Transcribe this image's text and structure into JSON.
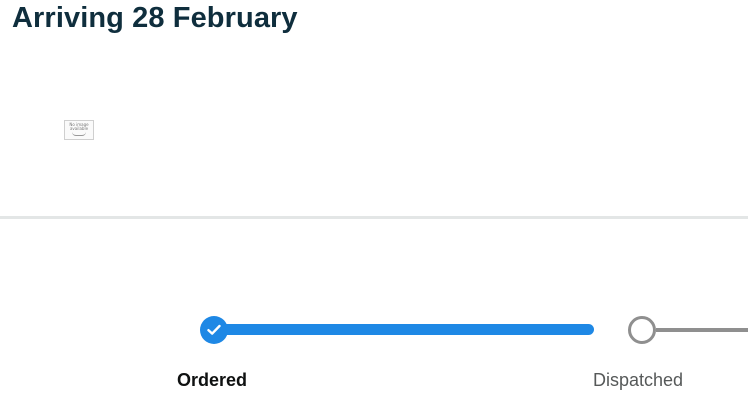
{
  "delivery": {
    "heading": "Arriving 28 February"
  },
  "item": {
    "image_placeholder_line1": "No image",
    "image_placeholder_line2": "available"
  },
  "progress": {
    "steps": [
      {
        "label": "Ordered",
        "status": "complete"
      },
      {
        "label": "Dispatched",
        "status": "pending"
      }
    ],
    "current_step": "Ordered"
  },
  "colors": {
    "heading": "#0f2e3d",
    "progress_complete": "#1e88e5",
    "progress_pending": "#8f8f8f",
    "divider": "#e3e6e6"
  }
}
